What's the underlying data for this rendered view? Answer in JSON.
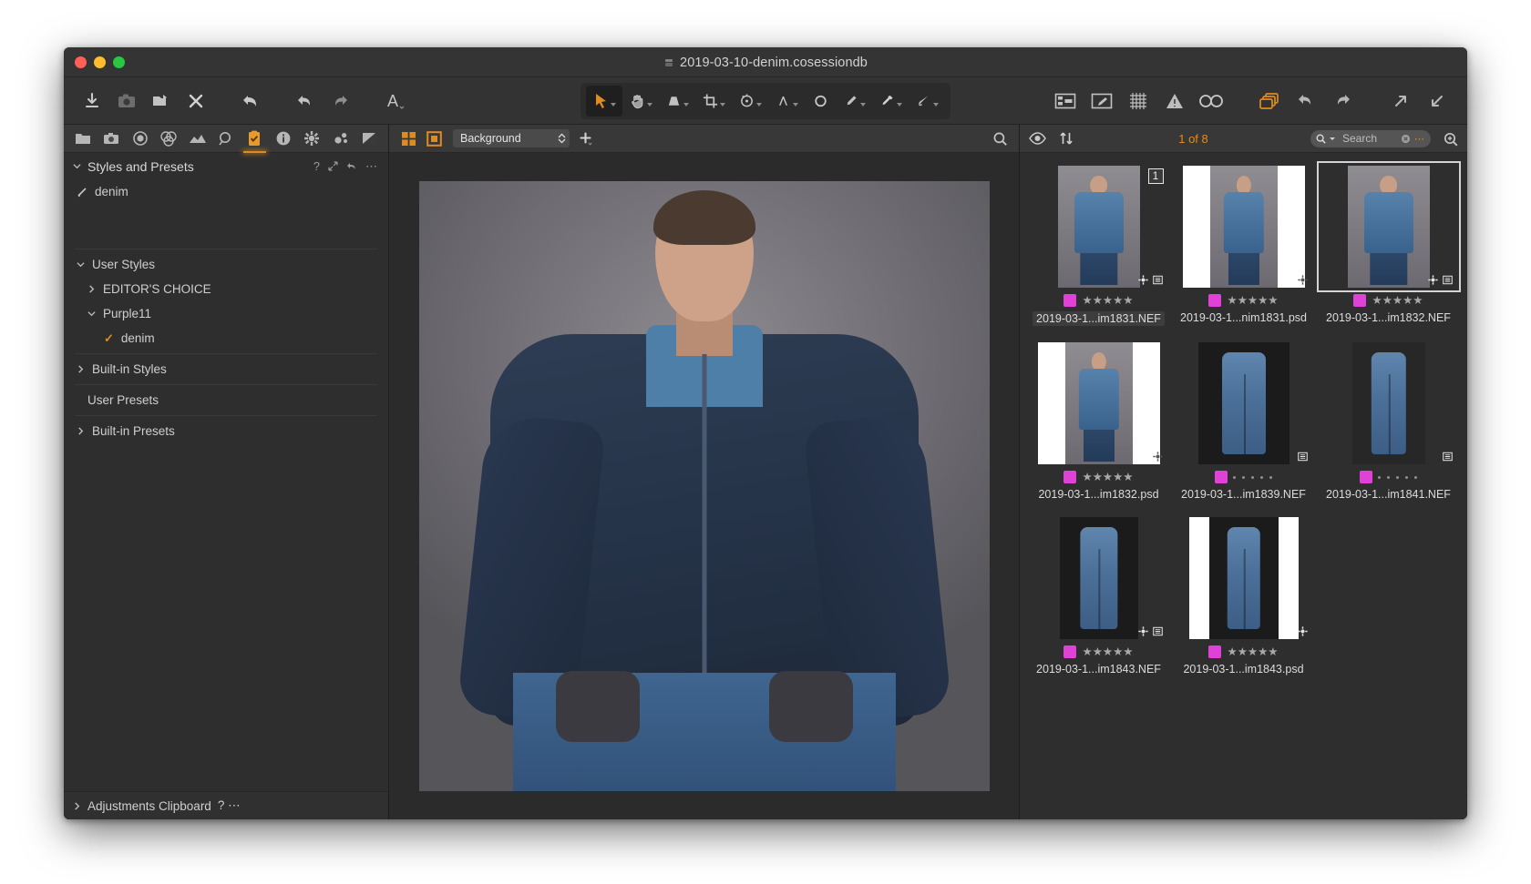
{
  "window": {
    "title": "2019-03-10-denim.cosessiondb",
    "title_icon": "session-db-icon",
    "traffic_lights": [
      "close-button",
      "minimize-button",
      "zoom-button"
    ]
  },
  "main_toolbar": {
    "left_tools": [
      {
        "name": "import-icon",
        "label": "Import"
      },
      {
        "name": "capture-camera-icon",
        "label": "Capture"
      },
      {
        "name": "export-folder-icon",
        "label": "Export"
      },
      {
        "name": "delete-x-icon",
        "label": "Delete"
      },
      {
        "name": "reset-arrow-icon",
        "label": "Reset"
      },
      {
        "name": "undo-icon",
        "label": "Undo"
      },
      {
        "name": "redo-icon",
        "label": "Redo"
      },
      {
        "name": "text-a-icon",
        "label": "Annotate Text"
      }
    ],
    "center_tools": [
      {
        "name": "pointer-tool-icon",
        "label": "Select",
        "selected": true,
        "has_menu": true
      },
      {
        "name": "pan-hand-tool-icon",
        "label": "Pan",
        "selected": false,
        "has_menu": true
      },
      {
        "name": "keystone-tool-icon",
        "label": "Keystone",
        "selected": false,
        "has_menu": true
      },
      {
        "name": "crop-tool-icon",
        "label": "Crop",
        "selected": false,
        "has_menu": true
      },
      {
        "name": "rotate-tool-icon",
        "label": "Rotate",
        "selected": false,
        "has_menu": true
      },
      {
        "name": "straighten-tool-icon",
        "label": "Straighten",
        "selected": false,
        "has_menu": true
      },
      {
        "name": "spot-removal-tool-icon",
        "label": "Spot Removal",
        "selected": false,
        "has_menu": false
      },
      {
        "name": "brush-tool-icon",
        "label": "Draw Mask",
        "selected": false,
        "has_menu": true
      },
      {
        "name": "eyedropper-tool-icon",
        "label": "White Balance Picker",
        "selected": false,
        "has_menu": true
      },
      {
        "name": "heal-tool-icon",
        "label": "Heal",
        "selected": false,
        "has_menu": true
      }
    ],
    "right_tools": [
      {
        "name": "viewer-layout-icon",
        "label": "Viewer"
      },
      {
        "name": "annotation-edit-icon",
        "label": "Edit"
      },
      {
        "name": "grid-overlay-icon",
        "label": "Grid"
      },
      {
        "name": "exposure-warning-icon",
        "label": "Exposure Warning"
      },
      {
        "name": "focus-mask-glasses-icon",
        "label": "Focus Mask"
      },
      {
        "name": "variants-stack-icon",
        "label": "Variants",
        "accent": true
      },
      {
        "name": "reset-variant-icon",
        "label": "Reset"
      },
      {
        "name": "fullscreen-expand-icon",
        "label": "Full Screen"
      },
      {
        "name": "collapse-panels-icon",
        "label": "Collapse"
      }
    ]
  },
  "left_panel": {
    "tabs": [
      {
        "name": "library-folder-tab",
        "label": "Library",
        "active": false
      },
      {
        "name": "capture-tab",
        "label": "Capture",
        "active": false
      },
      {
        "name": "lens-tab",
        "label": "Lens",
        "active": false
      },
      {
        "name": "color-tab",
        "label": "Color",
        "active": false
      },
      {
        "name": "exposure-tab",
        "label": "Exposure",
        "active": false
      },
      {
        "name": "details-loupe-tab",
        "label": "Details",
        "active": false
      },
      {
        "name": "adjustments-clipboard-tab",
        "label": "Adjustments",
        "active": true
      },
      {
        "name": "metadata-info-tab",
        "label": "Metadata",
        "active": false
      },
      {
        "name": "output-gear-tab",
        "label": "Output",
        "active": false
      },
      {
        "name": "batch-gears-tab",
        "label": "Batch",
        "active": false
      },
      {
        "name": "levels-tab",
        "label": "Levels",
        "active": false
      }
    ],
    "panel_title": "Styles and Presets",
    "panel_actions": [
      "help-question-icon",
      "expand-arrows-icon",
      "reset-curve-icon",
      "more-dots-icon"
    ],
    "applied_style": "denim",
    "applied_style_icon": "style-stroke-icon",
    "tree": [
      {
        "label": "User Styles",
        "level": 0,
        "state": "expanded",
        "checked": false
      },
      {
        "label": "EDITOR'S CHOICE",
        "level": 1,
        "state": "collapsed",
        "checked": false
      },
      {
        "label": "Purple11",
        "level": 1,
        "state": "expanded",
        "checked": false
      },
      {
        "label": "denim",
        "level": 2,
        "state": "leaf",
        "checked": true
      },
      {
        "label": "Built-in Styles",
        "level": 0,
        "state": "collapsed",
        "checked": false
      },
      {
        "label": "User Presets",
        "level": 0,
        "state": "none",
        "checked": false
      },
      {
        "label": "Built-in Presets",
        "level": 0,
        "state": "collapsed",
        "checked": false
      }
    ],
    "footer": {
      "label": "Adjustments Clipboard",
      "state": "collapsed",
      "actions": [
        "help-question-icon",
        "more-dots-icon"
      ]
    }
  },
  "viewer": {
    "toolbar": {
      "grid_view_icon": "multi-view-icon",
      "single_view_icon": "single-view-icon",
      "background_select": {
        "value": "Background",
        "options": [
          "Background"
        ]
      },
      "add_icon": "add-plus-icon",
      "zoom_icon": "zoom-magnifier-icon"
    },
    "image_alt": "Portrait of a man in a dark denim jacket seated against grey backdrop"
  },
  "browser": {
    "toolbar": {
      "visibility_icon": "eye-icon",
      "sort_icon": "sort-arrows-icon",
      "counter": "1 of 8",
      "search": {
        "placeholder": "Search",
        "value": "",
        "icon": "search-magnifier-icon",
        "clear_icon": "clear-circle-icon",
        "more_icon": "more-dots-icon"
      },
      "zoom_icon": "zoom-magnifier-icon"
    },
    "thumbnails": [
      {
        "filename": "2019-03-1...im1831.NEF",
        "color_label": "#e042d7",
        "rating": 5,
        "badge": "1",
        "selected": false,
        "filename_highlighted": true,
        "kind": "person",
        "matte": "none",
        "icons": [
          "settings-gear-icon",
          "metadata-list-icon"
        ]
      },
      {
        "filename": "2019-03-1...nim1831.psd",
        "color_label": "#e042d7",
        "rating": 5,
        "badge": null,
        "selected": false,
        "filename_highlighted": false,
        "kind": "person",
        "matte": "white",
        "icons": [
          "settings-gear-icon"
        ]
      },
      {
        "filename": "2019-03-1...im1832.NEF",
        "color_label": "#e042d7",
        "rating": 5,
        "badge": null,
        "selected": true,
        "filename_highlighted": false,
        "kind": "person",
        "matte": "none",
        "icons": [
          "settings-gear-icon",
          "metadata-list-icon"
        ]
      },
      {
        "filename": "2019-03-1...im1832.psd",
        "color_label": "#e042d7",
        "rating": 5,
        "badge": null,
        "selected": false,
        "filename_highlighted": false,
        "kind": "person",
        "matte": "white",
        "icons": [
          "settings-gear-icon"
        ]
      },
      {
        "filename": "2019-03-1...im1839.NEF",
        "color_label": "#e042d7",
        "rating": 0,
        "badge": null,
        "selected": false,
        "filename_highlighted": false,
        "kind": "jeans",
        "matte": "none",
        "icons": [
          "metadata-list-icon"
        ]
      },
      {
        "filename": "2019-03-1...im1841.NEF",
        "color_label": "#e042d7",
        "rating": 0,
        "badge": null,
        "selected": false,
        "filename_highlighted": false,
        "kind": "jeans",
        "matte": "none",
        "icons": [
          "metadata-list-icon"
        ]
      },
      {
        "filename": "2019-03-1...im1843.NEF",
        "color_label": "#e042d7",
        "rating": 5,
        "badge": null,
        "selected": false,
        "filename_highlighted": false,
        "kind": "jeans",
        "matte": "none",
        "icons": [
          "settings-gear-icon",
          "metadata-list-icon"
        ]
      },
      {
        "filename": "2019-03-1...im1843.psd",
        "color_label": "#e042d7",
        "rating": 5,
        "badge": null,
        "selected": false,
        "filename_highlighted": false,
        "kind": "jeans",
        "matte": "white",
        "icons": [
          "settings-gear-icon"
        ]
      }
    ]
  },
  "colors": {
    "accent": "#e08b20",
    "color_label": "#e042d7",
    "window_bg": "#2e2e2e",
    "toolbar_bg": "#383838"
  }
}
